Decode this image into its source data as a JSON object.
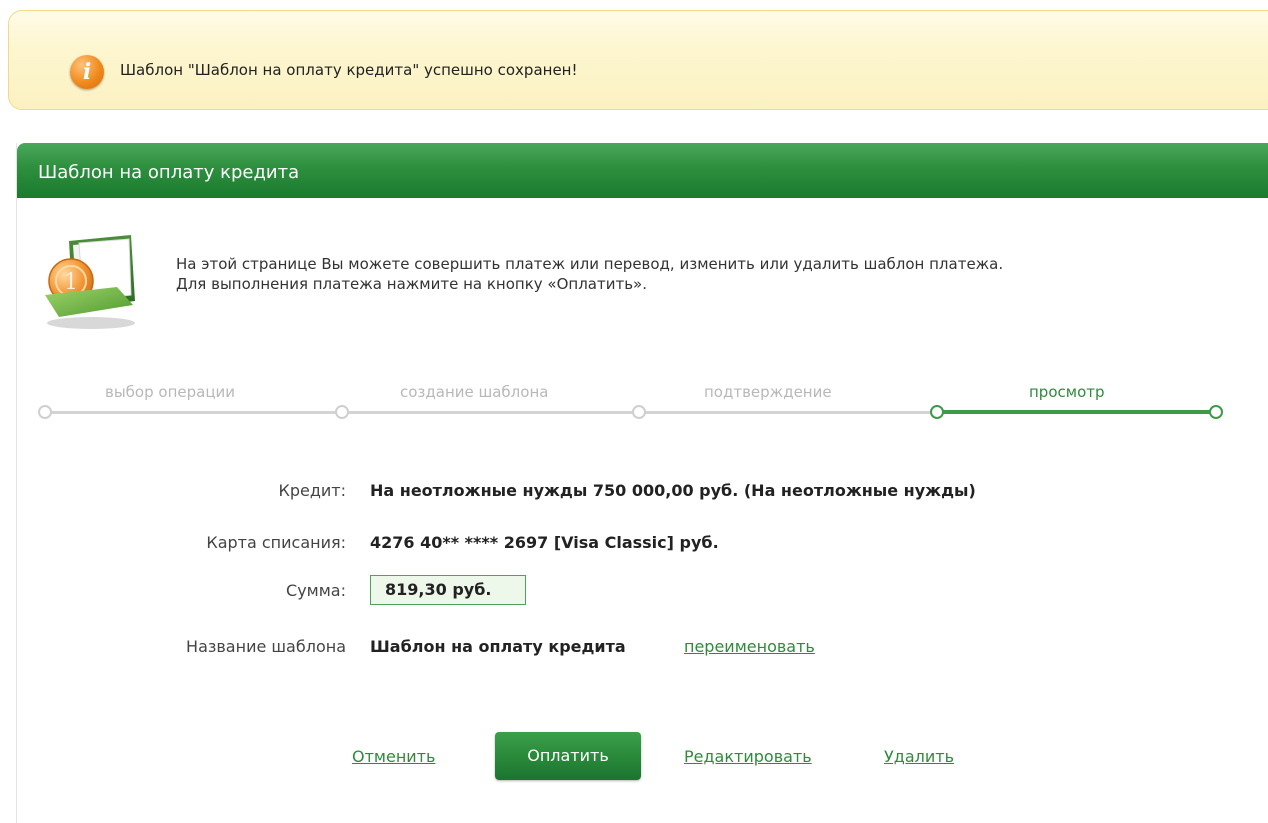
{
  "notification": {
    "icon": "info-icon",
    "message": "Шаблон \"Шаблон на оплату кредита\" успешно сохранен!"
  },
  "panel": {
    "title": "Шаблон на оплату кредита",
    "intro_line1": "На этой странице Вы можете совершить платеж или перевод, изменить или удалить шаблон платежа.",
    "intro_line2": "Для выполнения платежа нажмите на кнопку «Оплатить»."
  },
  "steps": [
    {
      "label": "выбор операции",
      "active": false
    },
    {
      "label": "создание шаблона",
      "active": false
    },
    {
      "label": "подтверждение",
      "active": false
    },
    {
      "label": "просмотр",
      "active": true
    }
  ],
  "details": {
    "credit_label": "Кредит:",
    "credit_value": "На неотложные нужды  750 000,00  руб.  (На неотложные нужды)",
    "card_label": "Карта списания:",
    "card_value": "4276 40** **** 2697  [Visa Classic]  руб.",
    "amount_label": "Сумма:",
    "amount_value": "819,30  руб.",
    "name_label": "Название шаблона",
    "name_value": "Шаблон на оплату кредита",
    "rename_link": "переименовать"
  },
  "actions": {
    "cancel": "Отменить",
    "pay": "Оплатить",
    "edit": "Редактировать",
    "delete": "Удалить"
  },
  "colors": {
    "accent_green": "#2e8b3a",
    "header_green": "#1a7a2e",
    "notice_bg": "#fdf6cf",
    "notice_border": "#f0d98a",
    "inactive_step": "#b8b8b8"
  }
}
